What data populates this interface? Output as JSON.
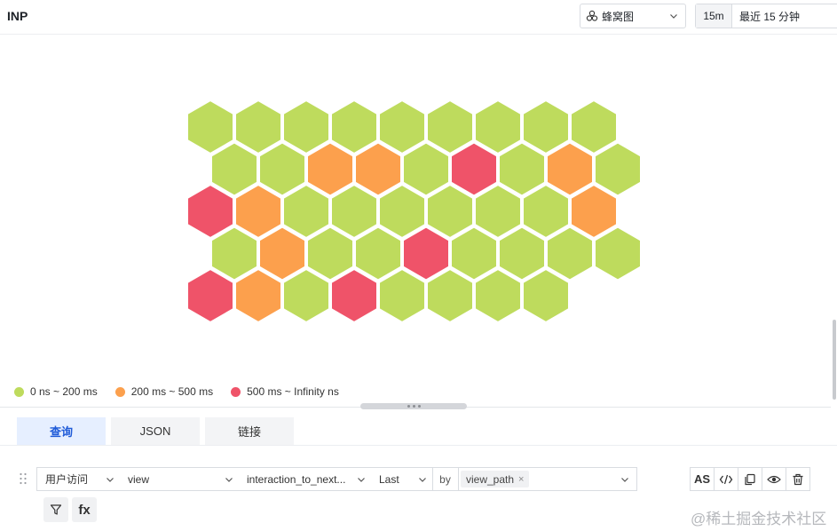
{
  "header": {
    "title": "INP",
    "visualization": {
      "label": "蜂窝图",
      "icon": "honeycomb-icon"
    },
    "time": {
      "short": "15m",
      "range": "最近 15 分钟"
    }
  },
  "chart_data": {
    "type": "honeycomb",
    "colors": {
      "low": "#bedb5d",
      "mid": "#fca04d",
      "high": "#ef5369"
    },
    "rows": [
      [
        "low",
        "low",
        "low",
        "low",
        "low",
        "low",
        "low",
        "low",
        "low"
      ],
      [
        "low",
        "low",
        "mid",
        "mid",
        "low",
        "high",
        "low",
        "mid",
        "low"
      ],
      [
        "high",
        "mid",
        "low",
        "low",
        "low",
        "low",
        "low",
        "low",
        "mid"
      ],
      [
        "low",
        "mid",
        "low",
        "low",
        "high",
        "low",
        "low",
        "low",
        "low"
      ],
      [
        "high",
        "mid",
        "low",
        "high",
        "low",
        "low",
        "low",
        "low"
      ]
    ],
    "legend": [
      {
        "label": "0 ns ~ 200 ms",
        "level": "low"
      },
      {
        "label": "200 ms ~ 500 ms",
        "level": "mid"
      },
      {
        "label": "500 ms ~ Infinity ns",
        "level": "high"
      }
    ]
  },
  "tabs": [
    "查询",
    "JSON",
    "链接"
  ],
  "query": {
    "source": "用户访问",
    "measurement": "view",
    "field": "interaction_to_next...",
    "aggregation": "Last",
    "by_label": "by",
    "group_by_tag": "view_path",
    "tag_close": "×",
    "as_label": "AS",
    "fx_label": "fx"
  },
  "watermark": "@稀土掘金技术社区"
}
